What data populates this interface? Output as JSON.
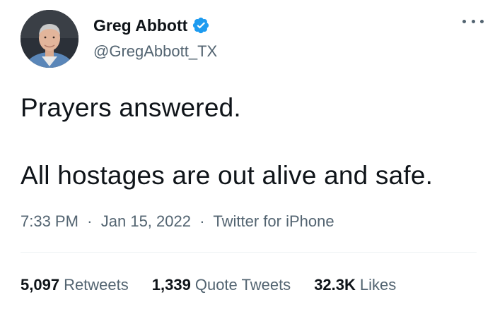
{
  "author": {
    "name": "Greg Abbott",
    "handle": "@GregAbbott_TX",
    "verified": true
  },
  "tweet": {
    "lines": [
      "Prayers answered.",
      "All hostages are out alive and safe."
    ]
  },
  "meta": {
    "time": "7:33 PM",
    "separator": "·",
    "date": "Jan 15, 2022",
    "source": "Twitter for iPhone"
  },
  "stats": [
    {
      "count": "5,097",
      "label": "Retweets"
    },
    {
      "count": "1,339",
      "label": "Quote Tweets"
    },
    {
      "count": "32.3K",
      "label": "Likes"
    }
  ],
  "colors": {
    "text": "#0f1419",
    "secondary": "#536471",
    "verified": "#1d9bf0",
    "divider": "#eff3f4"
  },
  "icons": [
    "avatar-photo",
    "verified-badge-icon",
    "more-options-icon"
  ]
}
